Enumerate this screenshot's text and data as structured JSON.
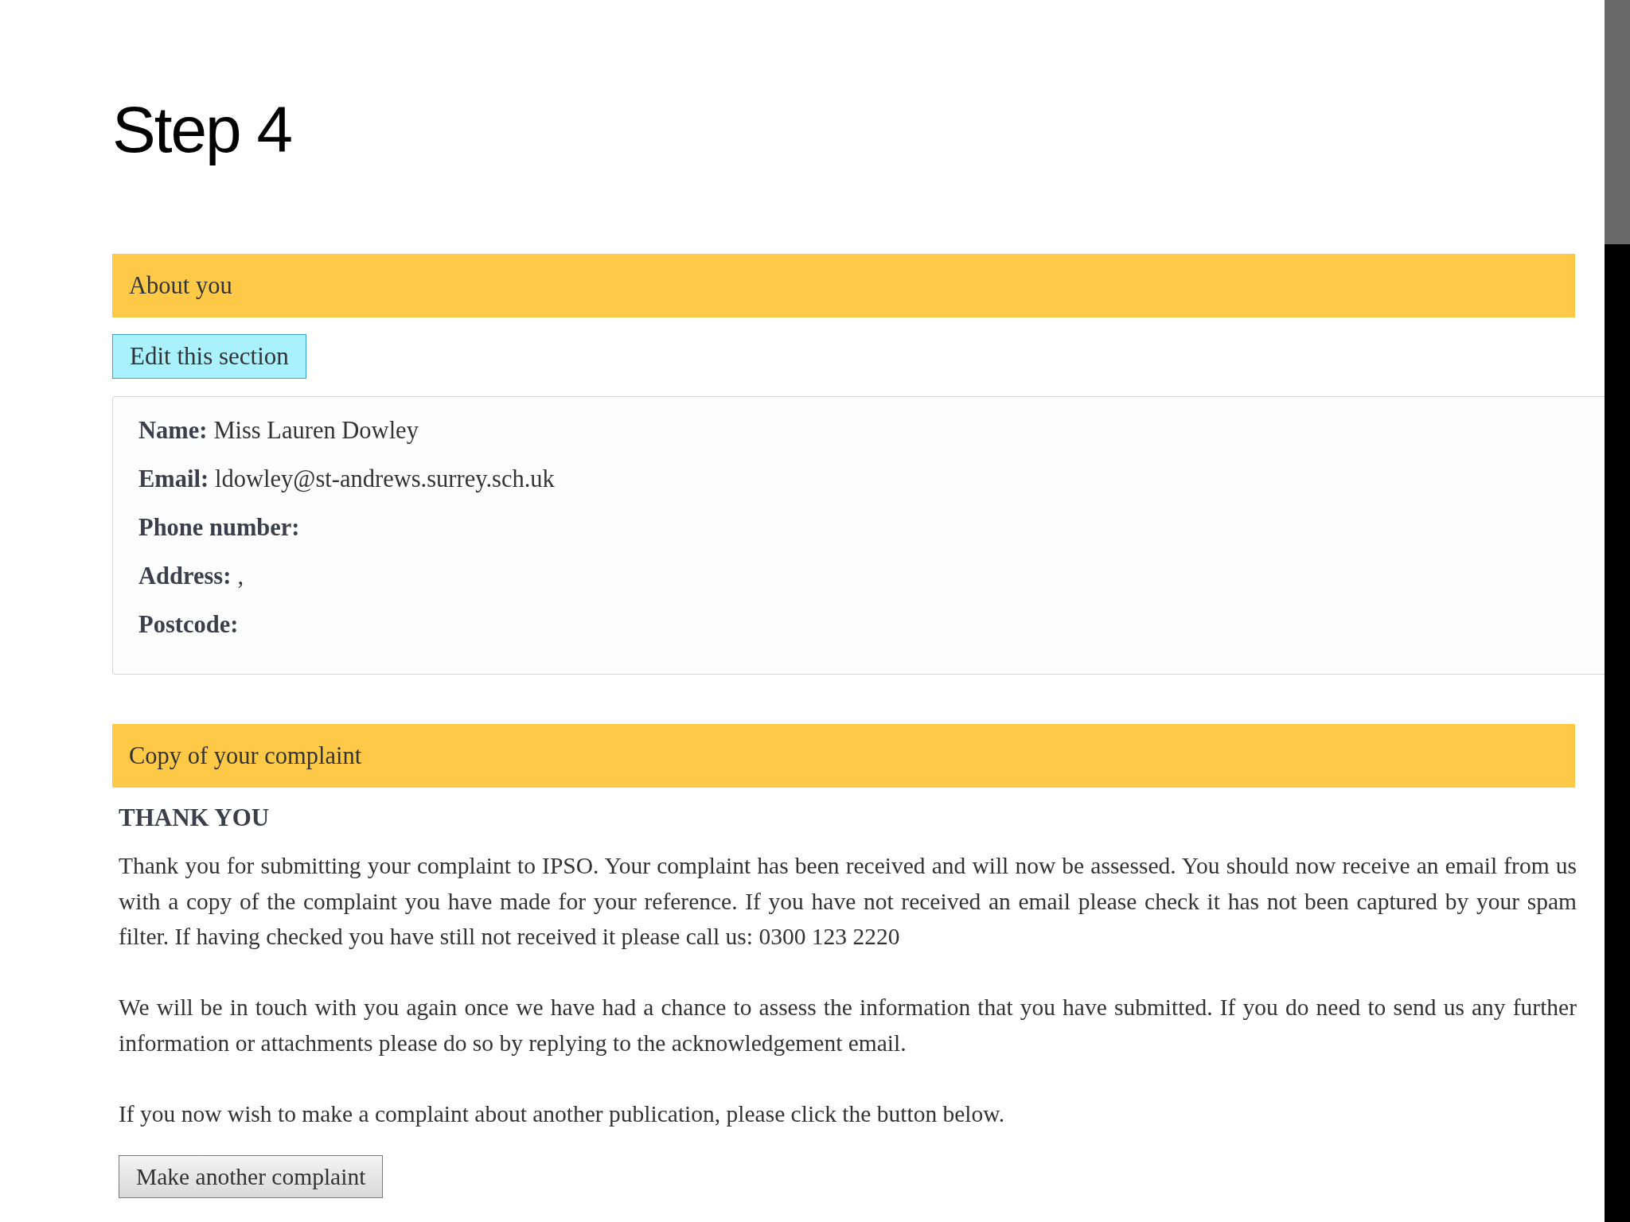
{
  "heading": "Step 4",
  "sections": [
    {
      "kind": "details",
      "title": "About you",
      "edit_button": "Edit this section",
      "fields": [
        {
          "label": "Name:",
          "value": "Miss Lauren Dowley"
        },
        {
          "label": "Email:",
          "value": "ldowley@st-andrews.surrey.sch.uk"
        },
        {
          "label": "Phone number:"
        },
        {
          "label": "Address:",
          "value": ","
        },
        {
          "label": "Postcode:"
        }
      ]
    },
    {
      "kind": "message",
      "title": "Copy of your complaint",
      "message_title": "THANK YOU",
      "paragraphs": [
        "Thank you for submitting your complaint to IPSO. Your complaint has been received and will now be assessed. You should now receive an email from us with a copy of the complaint you have made for your reference. If you have not received an email please check it has not been captured by your spam filter. If having checked you have still not received it please call us: 0300 123 2220",
        "We will be in touch with you again once we have had a chance to assess the information that you have submitted. If you do need to send us any further information or attachments please do so by replying to the acknowledgement email.",
        "If you now wish to make a complaint about another publication, please click the button below."
      ],
      "button": "Make another complaint"
    }
  ]
}
